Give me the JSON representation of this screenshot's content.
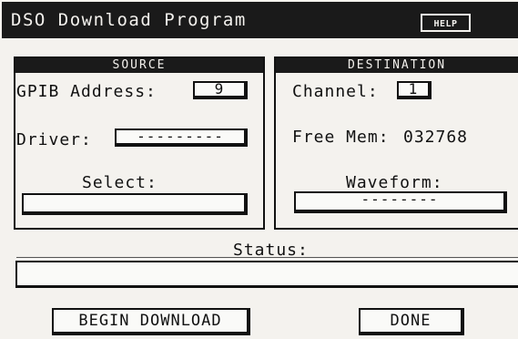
{
  "window": {
    "title": "DSO Download Program",
    "help_label": "HELP"
  },
  "source": {
    "heading": "SOURCE",
    "gpib_label": "GPIB Address:",
    "gpib_value": "9",
    "driver_label": "Driver:",
    "driver_value": "---------",
    "select_label": "Select:",
    "select_value": ""
  },
  "destination": {
    "heading": "DESTINATION",
    "channel_label": "Channel:",
    "channel_value": "1",
    "free_mem_label": "Free Mem:",
    "free_mem_value": "032768",
    "waveform_label": "Waveform:",
    "waveform_value": "--------"
  },
  "status": {
    "label": "Status:",
    "value": ""
  },
  "buttons": {
    "begin_download": "BEGIN DOWNLOAD",
    "done": "DONE"
  }
}
